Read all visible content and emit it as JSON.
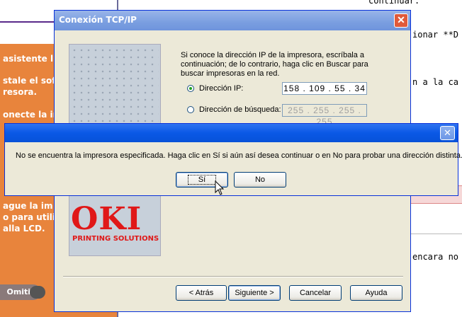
{
  "background": {
    "left_texts": [
      "asistente l",
      "stale el sof",
      "resora.",
      "onecte la in",
      "ague la im",
      "o para utili",
      "alla LCD."
    ],
    "code_lines": [
      "continuar.",
      "ionar **D",
      "n a la ca",
      "encara no"
    ],
    "skip_label": "Omitir"
  },
  "dialog": {
    "title": "Conexión TCP/IP",
    "description": "Si conoce la dirección IP de la impresora, escríbala a continuación; de lo contrario, haga clic en Buscar para buscar impresoras en la red.",
    "radio_ip_label": "Dirección IP:",
    "ip_value": "158 . 109 .  55  .  34",
    "radio_search_label": "Dirección de búsqueda:",
    "search_value": "255 . 255 . 255 . 255",
    "logo_text": "OKI",
    "logo_subtext": "PRINTING SOLUTIONS",
    "buttons": {
      "back": "< Atrás",
      "next": "Siguiente >",
      "cancel": "Cancelar",
      "help": "Ayuda"
    }
  },
  "error_dialog": {
    "message": "No se encuentra la impresora especificada. Haga clic en Sí si aún así desea continuar o en No para probar una dirección distinta.",
    "yes_label": "Sí",
    "no_label": "No"
  }
}
